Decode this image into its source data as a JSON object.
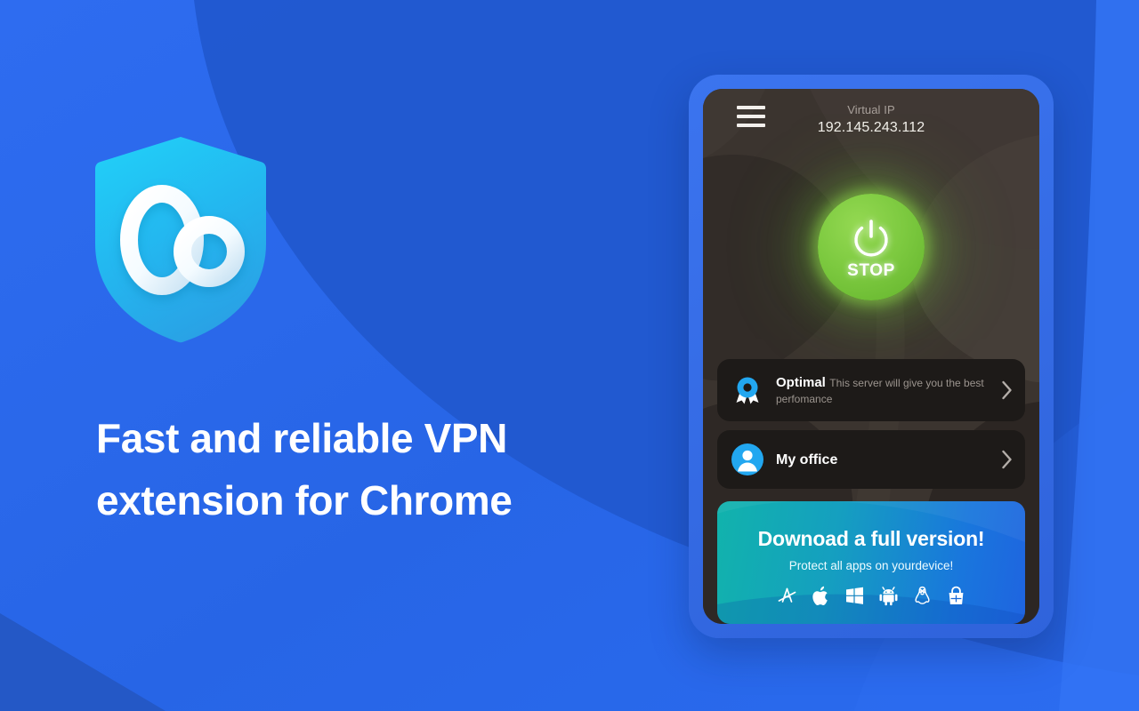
{
  "page": {
    "background_color": "#2767e8",
    "background_accent": "#2159cf",
    "background_light": "#3374f5"
  },
  "hero": {
    "logo_icon": "shield-infinity-logo",
    "logo_colors": {
      "top": "#24c9f5",
      "bottom": "#2aa8e8",
      "mark": "#ffffff"
    },
    "headline_line1": "Fast and reliable VPN",
    "headline_line2": "extension for Chrome",
    "headline_color": "#ffffff"
  },
  "phone": {
    "frame_color": "#3b74ef",
    "screen_color": "#3b342f",
    "header": {
      "menu_icon": "hamburger-menu-icon",
      "ip_label": "Virtual IP",
      "ip_value": "192.145.243.112"
    },
    "power": {
      "icon": "power-icon",
      "label": "STOP",
      "state_color": "#7cc93f",
      "glow_color": "#8cd648"
    },
    "servers": [
      {
        "icon": "award-badge-icon",
        "icon_color": "#22a7f0",
        "title": "Optimal",
        "subtitle": "This server will give you the best perfomance",
        "chevron": "chevron-right-icon"
      },
      {
        "icon": "user-avatar-icon",
        "icon_color": "#22a7f0",
        "title": "My office",
        "subtitle": "",
        "chevron": "chevron-right-icon"
      }
    ],
    "promo": {
      "title": "Downoad a full version!",
      "subtitle": "Protect all apps on yourdevice!",
      "gradient_from": "#11b3ac",
      "gradient_to": "#1f64e0",
      "platforms": [
        {
          "name": "mac-app-store-icon",
          "label": "Mac App Store"
        },
        {
          "name": "apple-icon",
          "label": "Apple"
        },
        {
          "name": "windows-icon",
          "label": "Windows"
        },
        {
          "name": "android-icon",
          "label": "Android"
        },
        {
          "name": "linux-icon",
          "label": "Linux"
        },
        {
          "name": "microsoft-store-icon",
          "label": "Microsoft Store"
        }
      ]
    }
  }
}
